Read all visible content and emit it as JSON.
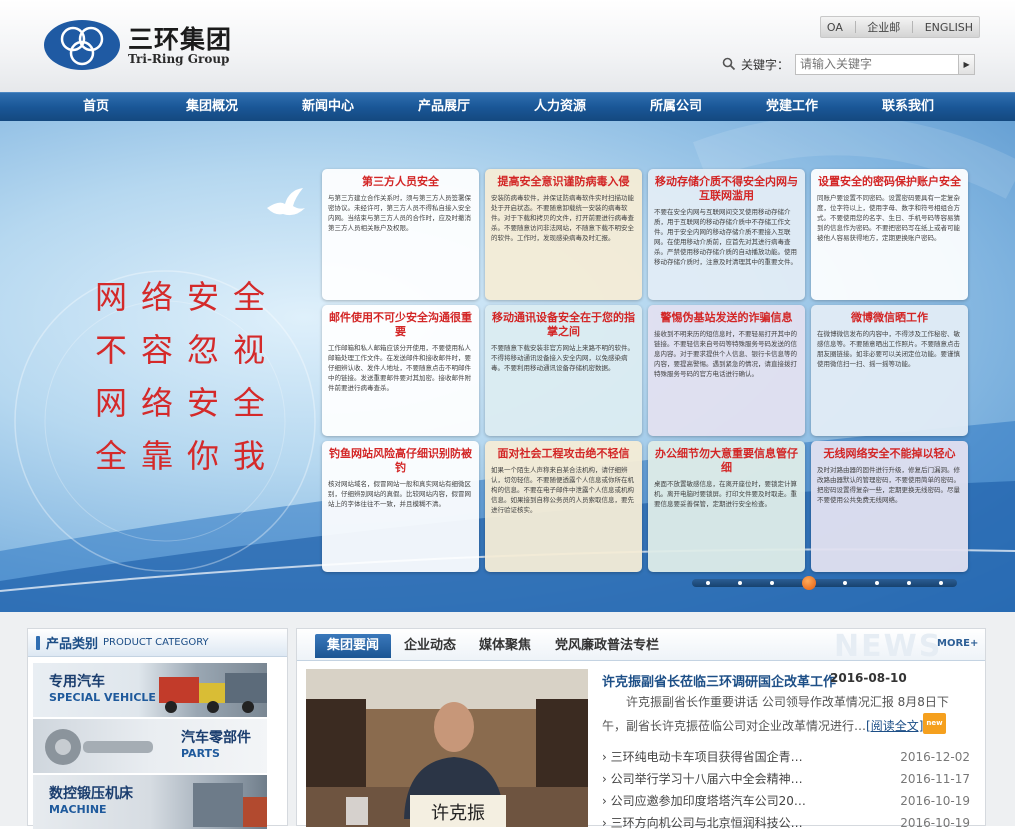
{
  "header": {
    "logo_cn": "三环集团",
    "logo_en": "Tri-Ring Group",
    "top_links": [
      "OA",
      "企业邮",
      "ENGLISH"
    ],
    "search_label": "关键字：",
    "search_placeholder": "请输入关键字",
    "search_button_icon": "triangle-right-icon"
  },
  "nav": [
    "首页",
    "集团概况",
    "新闻中心",
    "产品展厅",
    "人力资源",
    "所属公司",
    "党建工作",
    "联系我们"
  ],
  "banner": {
    "slogan": [
      "网络安全",
      "不容忽视",
      "网络安全",
      "全靠你我"
    ],
    "cards": [
      {
        "title": "第三方人员安全",
        "body": "与第三方建立合作关系时，须与第三方人员签署保密协议。未经许可，第三方人员不得私自接入安全内网。当结束与第三方人员的合作时，应及时撤消第三方人员相关账户及权限。"
      },
      {
        "title": "提高安全意识谨防病毒入侵",
        "body": "安装防病毒软件，并保证防病毒软件实时扫描功能处于开启状态。不要随意卸载统一安装的病毒软件。对于下载和拷贝的文件，打开前要进行病毒查杀。不要随意访问非法网站，不随意下载不明安全的软件。工作时，发现感染病毒及时汇报。"
      },
      {
        "title": "移动存储介质不得安全内网与互联网滥用",
        "body": "不要在安全内网与互联网间交叉使用移动存储介质，用于互联网的移动存储介质中不存储工作文件。用于安全内网的移动存储介质不要接入互联网。在使用移动介质前，应首先对其进行病毒查杀。严禁使用移动存储介质的自动播放功能。使用移动存储介质时，注意及时清理其中的重要文件。"
      },
      {
        "title": "设置安全的密码保护账户安全",
        "body": "同账户要设置不同密码。设置密码要具有一定复杂度，位字符以上，使用字母、数字和符号相组合方式。不要使用您的名字、生日、手机号码等容易猜到的信息作为密码。不要把密码写在纸上或者可能被他人容易获得地方，定期更换账户密码。"
      },
      {
        "title": "邮件使用不可少安全沟通很重要",
        "body": "工作邮箱和私人邮箱应该分开使用，不要使用私人邮箱处理工作文件。在发送邮件和接收邮件时，要仔细辨认收、发件人地址，不要随意点击不明邮件中的链接。发送重要邮件要对其加密。接收邮件附件前要进行病毒查杀。"
      },
      {
        "title": "移动通讯设备安全在于您的指掌之间",
        "body": "不要随意下载安装非官方网站上来路不明的软件。不得将移动通讯设备接入安全内网，以免感染病毒。不要利用移动通讯设备存储机密数据。"
      },
      {
        "title": "警惕伪基站发送的诈骗信息",
        "body": "接收到不明来历的短信息时，不要轻易打开其中的链接。不要轻信来自号码等特殊服务号码发送的信息内容。对于要求提供个人信息、银行卡信息等的内容，要提高警惕。遇到紧急的情况，请直接拨打特殊服务号码的官方电话进行确认。"
      },
      {
        "title": "微博微信晒工作",
        "body": "在微博微信发布的内容中，不得涉及工作秘密、敏感信息等。不要随意晒出工作照片。不要随意点击朋友圈链接。如非必要可以关闭定位功能。要谨慎使用微信扫一扫、摇一摇等功能。"
      },
      {
        "title": "钓鱼网站风险高仔细识别防被钓",
        "body": "核对网站域名，假冒网站一般和真实网站有细微区别，仔细辨别网站的真假。比较网站内容，假冒网站上的字体往往不一致，并且模糊不清。"
      },
      {
        "title": "面对社会工程攻击绝不轻信",
        "body": "如果一个陌生人声称来自某合法机构，请仔细辨认，切勿轻信。不要随便透露个人信息或你所在机构的信息。不要在电子邮件中泄露个人信息或机构信息。如果接到自称公务员的人员索取信息，要先进行验证核实。"
      },
      {
        "title": "办公细节勿大意重要信息管仔细",
        "body": "桌面不放置敏感信息，在离开座位时，要锁定计算机。离开电脑时要锁屏。打印文件要及时取走。重要信息要妥善保管，定期进行安全检查。"
      },
      {
        "title": "无线网络安全不能掉以轻心",
        "body": "及时对路由器的固件进行升级，修复后门漏洞。修改路由器默认的管理密码，不要使用简单的密码。把密码设置得复杂一些，定期更换无线密码。尽量不要使用公共免费无线网络。"
      }
    ],
    "slide_count": 8,
    "active_slide": 3
  },
  "categories": {
    "title": "产品类别",
    "title_en": "PRODUCT CATEGORY",
    "items": [
      {
        "cn": "专用汽车",
        "en": "SPECIAL VEHICLE"
      },
      {
        "cn": "汽车零部件",
        "en": "PARTS"
      },
      {
        "cn": "数控锻压机床",
        "en": "MACHINE"
      }
    ]
  },
  "news": {
    "tabs": [
      "集团要闻",
      "企业动态",
      "媒体聚焦",
      "党风廉政普法专栏"
    ],
    "active_tab": 0,
    "bg_text": "NEWS",
    "more_label": "MORE+",
    "feature": {
      "title": "许克振副省长莅临三环调研国企改革工作",
      "date": "2016-08-10",
      "text": "许克振副省长作重要讲话 公司领导作改革情况汇报 8月8日下午，副省长许克振莅临公司对企业改革情况进行…",
      "read_more": "[阅读全文]",
      "badge": "new",
      "photo_caption": "许克振"
    },
    "items": [
      {
        "title": "三环纯电动卡车项目获得省国企青…",
        "date": "2016-12-02"
      },
      {
        "title": "公司举行学习十八届六中全会精神…",
        "date": "2016-11-17"
      },
      {
        "title": "公司应邀参加印度塔塔汽车公司20…",
        "date": "2016-10-19"
      },
      {
        "title": "三环方向机公司与北京恒润科技公…",
        "date": "2016-10-19"
      }
    ]
  },
  "colors": {
    "nav_blue": "#1a5797",
    "slogan_red": "#d42a2a",
    "link_blue": "#1d4f87",
    "badge_orange": "#f5a01e"
  }
}
